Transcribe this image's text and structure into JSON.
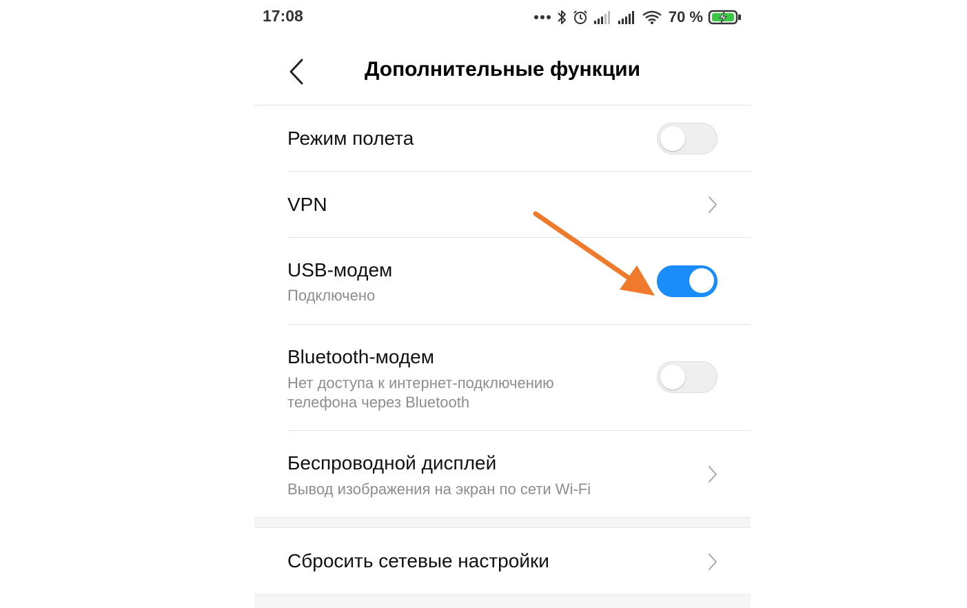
{
  "status_bar": {
    "time": "17:08",
    "battery_percent": "70 %",
    "icons": [
      "more-dots-icon",
      "bluetooth-icon",
      "alarm-icon",
      "signal-icon",
      "signal-icon",
      "wifi-icon",
      "battery-charging-icon"
    ]
  },
  "header": {
    "back_icon": "chevron-left-icon",
    "title": "Дополнительные функции"
  },
  "settings": [
    {
      "label": "Режим полета",
      "control": "toggle",
      "state": "off"
    },
    {
      "label": "VPN",
      "control": "chevron"
    },
    {
      "label": "USB-модем",
      "subtitle": "Подключено",
      "control": "toggle",
      "state": "on"
    },
    {
      "label": "Bluetooth-модем",
      "subtitle_lines": [
        "Нет доступа к интернет-подключению",
        "телефона через Bluetooth"
      ],
      "control": "toggle",
      "state": "off"
    },
    {
      "label": "Беспроводной дисплей",
      "subtitle": "Вывод изображения на экран по сети Wi-Fi",
      "control": "chevron"
    },
    {
      "label": "Сбросить сетевые настройки",
      "control": "chevron"
    }
  ],
  "colors": {
    "toggle_on": "#1a8dfa",
    "toggle_off": "#efefef",
    "annotation_arrow": "#f07a2c",
    "battery_fill": "#3cc845"
  },
  "annotation": {
    "type": "arrow",
    "points_to": "USB-модем toggle"
  }
}
